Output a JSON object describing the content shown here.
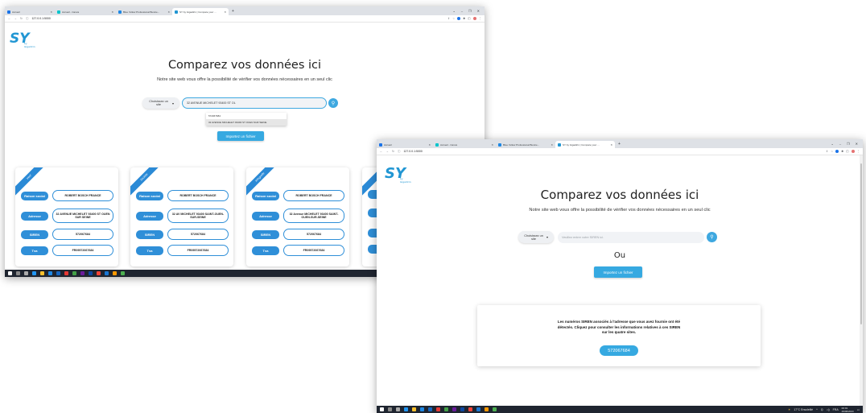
{
  "window1": {
    "tabs": [
      {
        "label": "Accueil",
        "color": "#1a73e8"
      },
      {
        "label": "Accueil - Canva",
        "color": "#00c4cc"
      },
      {
        "label": "Blue Yellow Professional Busine...",
        "color": "#1e88e5"
      },
      {
        "label": "SY by Gigadirin | Compare your ...",
        "color": "#2196d3"
      }
    ],
    "url": "127.0.0.1:5000",
    "logo": {
      "text": "SY",
      "sub": "by Gigadirin"
    },
    "title": "Comparez vos données ici",
    "subtitle": "Notre site web vous offre la possibilité de vérifier vos données nécessaires en un seul clic",
    "site_select": "Choisissez un site",
    "search_value": "32 AVENUE MICHELET 93400 ST OL",
    "suggestions": [
      "572067684",
      "32 AVENUE MICHELET 93400 ST OUEN SUR SEINE"
    ],
    "import_label": "Importez un fichier",
    "cards": [
      {
        "ribbon": "Verif",
        "rows": [
          {
            "label": "Raison social",
            "value": "ROBERT BOSCH FRANCE"
          },
          {
            "label": "Adresse",
            "value": "32 AVENUE MICHELET 93400 ST OUEN SUR SEINE"
          },
          {
            "label": "SIREN",
            "value": "572067684"
          },
          {
            "label": "Tva",
            "value": "FR09572067684"
          }
        ]
      },
      {
        "ribbon": "Societe",
        "rows": [
          {
            "label": "Raison social",
            "value": "ROBERT BOSCH FRANCE"
          },
          {
            "label": "Adresse",
            "value": "32 AV MICHELET 93400 SAINT-OUEN-SUR-SEINE"
          },
          {
            "label": "SIREN",
            "value": "572067684"
          },
          {
            "label": "Tva",
            "value": "FR09572067684"
          }
        ]
      },
      {
        "ribbon": "Infogreffe",
        "rows": [
          {
            "label": "Raison social",
            "value": "ROBERT BOSCH FRANCE"
          },
          {
            "label": "Adresse",
            "value": "32 Avenue MICHELET 93400 SAINT-OUEN-SUR-SEINE"
          },
          {
            "label": "SIREN",
            "value": "572067684"
          },
          {
            "label": "Tva",
            "value": "FR09572067684"
          }
        ]
      }
    ]
  },
  "window2": {
    "tabs": [
      {
        "label": "Accueil",
        "color": "#1a73e8"
      },
      {
        "label": "Accueil - Canva",
        "color": "#00c4cc"
      },
      {
        "label": "Blue Yellow Professional Busine...",
        "color": "#1e88e5"
      },
      {
        "label": "SY by Gigadirin | Compare your ...",
        "color": "#2196d3"
      }
    ],
    "url": "127.0.0.1:5000",
    "logo": {
      "text": "SY",
      "sub": "by Gigadirin"
    },
    "title": "Comparez vos données ici",
    "subtitle": "Notre site web vous offre la possibilité de vérifier vos données nécessaires en un seul clic",
    "site_select": "Choisissez un site",
    "search_placeholder": "Veuillez entrer votre SIREN ici.",
    "ou": "Ou",
    "import_label": "Importez un fichier",
    "siren_message": "Les numéros SIREN associés à l'adresse que vous avez fournie ont été détectés. Cliquez pour consulter les informations relatives à ces SIREN sur les quatre sites.",
    "siren_button": "572067684",
    "tray": {
      "weather": "17°C Ensoleillé",
      "lang": "FRA",
      "time": "00:01",
      "date": "29/06/2023"
    }
  }
}
